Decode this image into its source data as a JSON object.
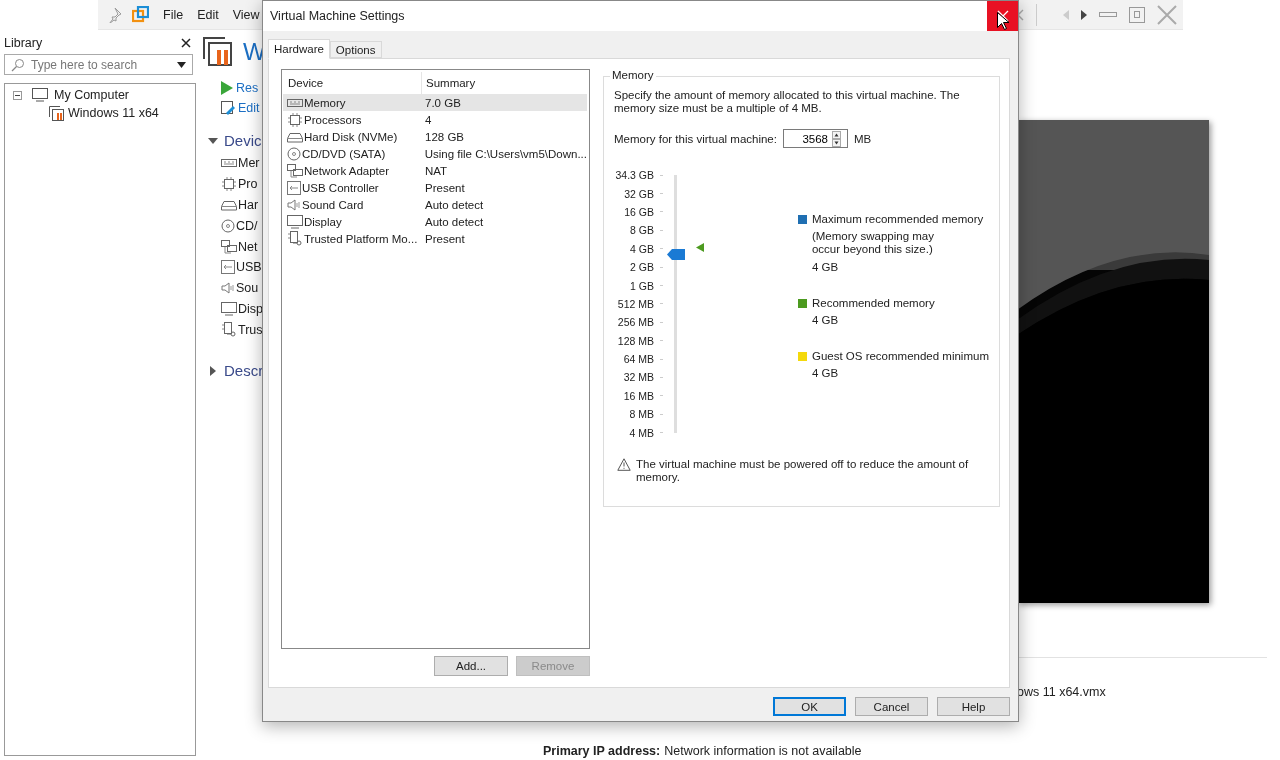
{
  "app": {
    "menu": [
      "File",
      "Edit",
      "View"
    ],
    "library": {
      "title": "Library",
      "search_placeholder": "Type here to search",
      "tree": [
        {
          "label": "My Computer",
          "kind": "computer",
          "expanded": true,
          "children": [
            {
              "label": "Windows 11 x64",
              "kind": "vm"
            }
          ]
        }
      ]
    },
    "vm_page": {
      "title": "W",
      "actions": [
        {
          "label": "Res",
          "kind": "play"
        },
        {
          "label": "Edit",
          "kind": "edit"
        }
      ],
      "devices_section": {
        "label": "Devic",
        "expanded": true,
        "items": [
          {
            "label": "Mer",
            "kind": "memory"
          },
          {
            "label": "Pro",
            "kind": "processor"
          },
          {
            "label": "Har",
            "kind": "disk"
          },
          {
            "label": "CD/",
            "kind": "cdrom"
          },
          {
            "label": "Net",
            "kind": "network"
          },
          {
            "label": "USB",
            "kind": "usb"
          },
          {
            "label": "Sou",
            "kind": "sound"
          },
          {
            "label": "Disp",
            "kind": "display"
          },
          {
            "label": "Trus",
            "kind": "tpm"
          }
        ]
      },
      "description_section": {
        "label": "Descr",
        "expanded": false
      },
      "config_file": "ows 11 x64.vmx",
      "ip": {
        "label": "Primary IP address:",
        "value": "Network information is not available"
      }
    }
  },
  "dialog": {
    "title": "Virtual Machine Settings",
    "tabs": [
      {
        "label": "Hardware",
        "selected": true
      },
      {
        "label": "Options",
        "selected": false
      }
    ],
    "device_table": {
      "columns": [
        "Device",
        "Summary"
      ],
      "rows": [
        {
          "kind": "memory",
          "device": "Memory",
          "summary": "7.0 GB",
          "selected": true
        },
        {
          "kind": "processor",
          "device": "Processors",
          "summary": "4",
          "selected": false
        },
        {
          "kind": "disk",
          "device": "Hard Disk (NVMe)",
          "summary": "128 GB",
          "selected": false
        },
        {
          "kind": "cdrom",
          "device": "CD/DVD (SATA)",
          "summary": "Using file C:\\Users\\vm5\\Down...",
          "selected": false
        },
        {
          "kind": "network",
          "device": "Network Adapter",
          "summary": "NAT",
          "selected": false
        },
        {
          "kind": "usb",
          "device": "USB Controller",
          "summary": "Present",
          "selected": false
        },
        {
          "kind": "sound",
          "device": "Sound Card",
          "summary": "Auto detect",
          "selected": false
        },
        {
          "kind": "display",
          "device": "Display",
          "summary": "Auto detect",
          "selected": false
        },
        {
          "kind": "tpm",
          "device": "Trusted Platform Mo...",
          "summary": "Present",
          "selected": false
        }
      ]
    },
    "list_buttons": [
      {
        "label": "Add...",
        "disabled": false
      },
      {
        "label": "Remove",
        "disabled": true
      }
    ],
    "memory": {
      "group_title": "Memory",
      "description": "Specify the amount of memory allocated to this virtual machine. The memory size must be a multiple of 4 MB.",
      "field_label": "Memory for this virtual machine:",
      "value": "3568",
      "unit": "MB",
      "scale": [
        {
          "label": "34.3 GB",
          "marker": false
        },
        {
          "label": "32 GB",
          "marker": false
        },
        {
          "label": "16 GB",
          "marker": false
        },
        {
          "label": "8 GB",
          "marker": false
        },
        {
          "label": "4 GB",
          "marker": true
        },
        {
          "label": "2 GB",
          "marker": false
        },
        {
          "label": "1 GB",
          "marker": false
        },
        {
          "label": "512 MB",
          "marker": false
        },
        {
          "label": "256 MB",
          "marker": false
        },
        {
          "label": "128 MB",
          "marker": false
        },
        {
          "label": "64 MB",
          "marker": false
        },
        {
          "label": "32 MB",
          "marker": false
        },
        {
          "label": "16 MB",
          "marker": false
        },
        {
          "label": "8 MB",
          "marker": false
        },
        {
          "label": "4 MB",
          "marker": false
        }
      ],
      "level": 0.69,
      "legend": [
        {
          "color": "#1f6fb2",
          "label": "Maximum recommended memory",
          "note": "(Memory swapping may occur beyond this size.)",
          "value": "4 GB"
        },
        {
          "color": "#4c9a1f",
          "label": "Recommended memory",
          "value": "4 GB"
        },
        {
          "color": "#f4d90c",
          "label": "Guest OS recommended minimum",
          "value": "4 GB"
        }
      ],
      "warning": "The virtual machine must be powered off to reduce the amount of memory."
    },
    "buttons": [
      {
        "label": "OK",
        "default": true
      },
      {
        "label": "Cancel",
        "default": false
      },
      {
        "label": "Help",
        "default": false
      }
    ]
  }
}
